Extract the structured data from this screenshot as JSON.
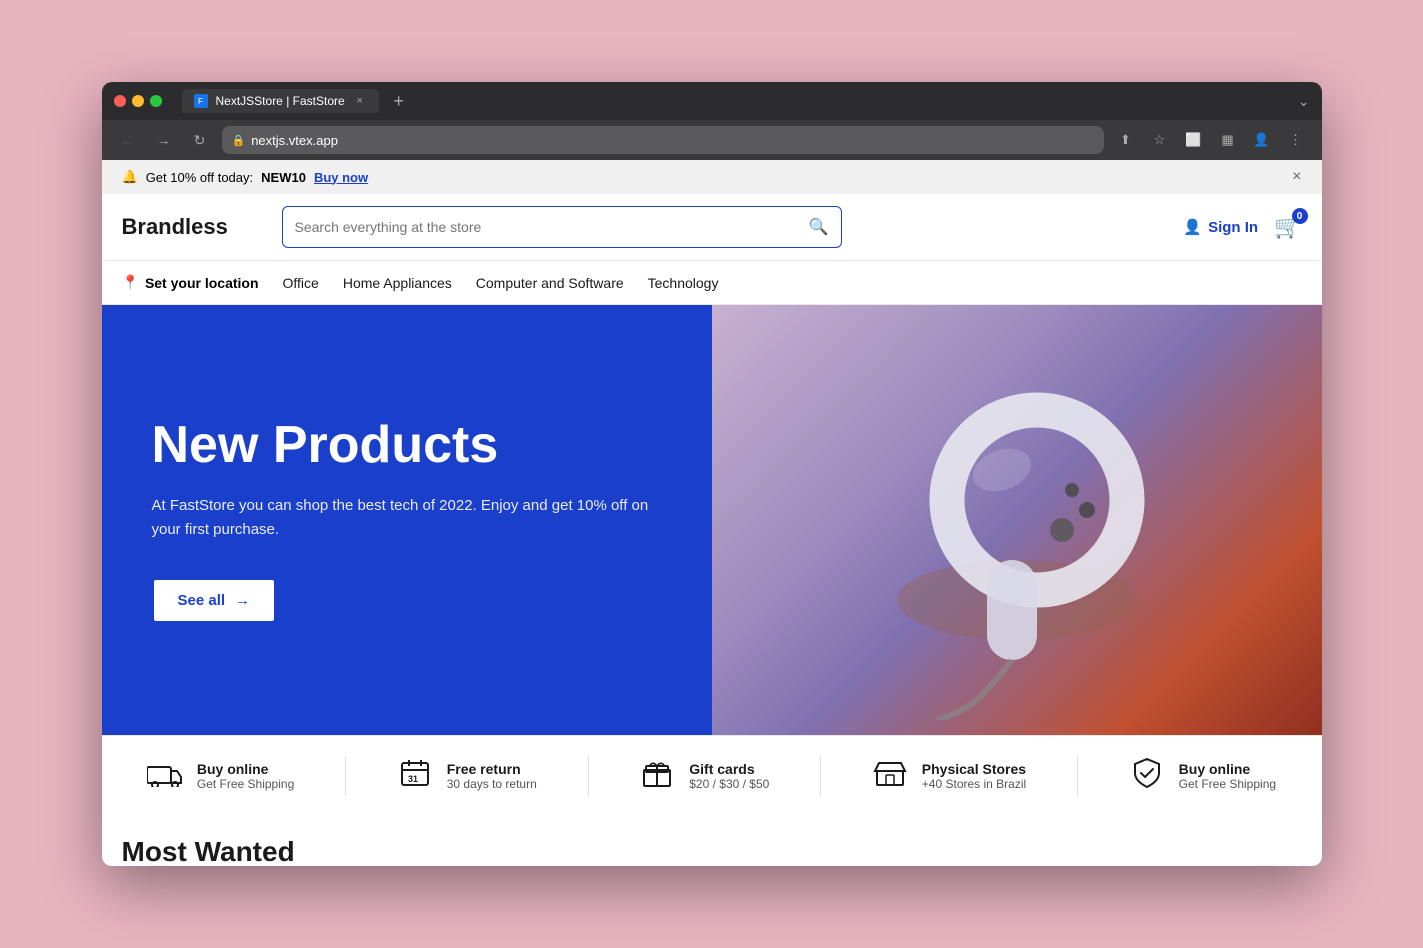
{
  "browser": {
    "tab_title": "NextJSStore | FastStore",
    "tab_favicon": "F",
    "url": "nextjs.vtex.app",
    "nav_back_disabled": false,
    "nav_forward_disabled": true
  },
  "announcement": {
    "text_prefix": "Get 10% off today:",
    "code": "NEW10",
    "link_text": "Buy now",
    "close_label": "×"
  },
  "header": {
    "logo": "Brandless",
    "search_placeholder": "Search everything at the store",
    "signin_label": "Sign In",
    "cart_count": "0"
  },
  "nav": {
    "location_label": "Set your location",
    "items": [
      {
        "label": "Office"
      },
      {
        "label": "Home Appliances"
      },
      {
        "label": "Computer and Software"
      },
      {
        "label": "Technology"
      }
    ]
  },
  "hero": {
    "title": "New Products",
    "description": "At FastStore you can shop the best tech of 2022. Enjoy and get 10% off on your first purchase.",
    "cta_label": "See all",
    "cta_arrow": "→"
  },
  "features": [
    {
      "icon": "🚚",
      "title": "Buy online",
      "subtitle": "Get Free Shipping"
    },
    {
      "icon": "📅",
      "title": "Free return",
      "subtitle": "30 days to return"
    },
    {
      "icon": "🎁",
      "title": "Gift cards",
      "subtitle": "$20 / $30 / $50"
    },
    {
      "icon": "🏪",
      "title": "Physical Stores",
      "subtitle": "+40 Stores in Brazil"
    },
    {
      "icon": "🛡",
      "title": "Buy online",
      "subtitle": "Get Free Shipping"
    }
  ],
  "next_section_title": "Most Wanted"
}
